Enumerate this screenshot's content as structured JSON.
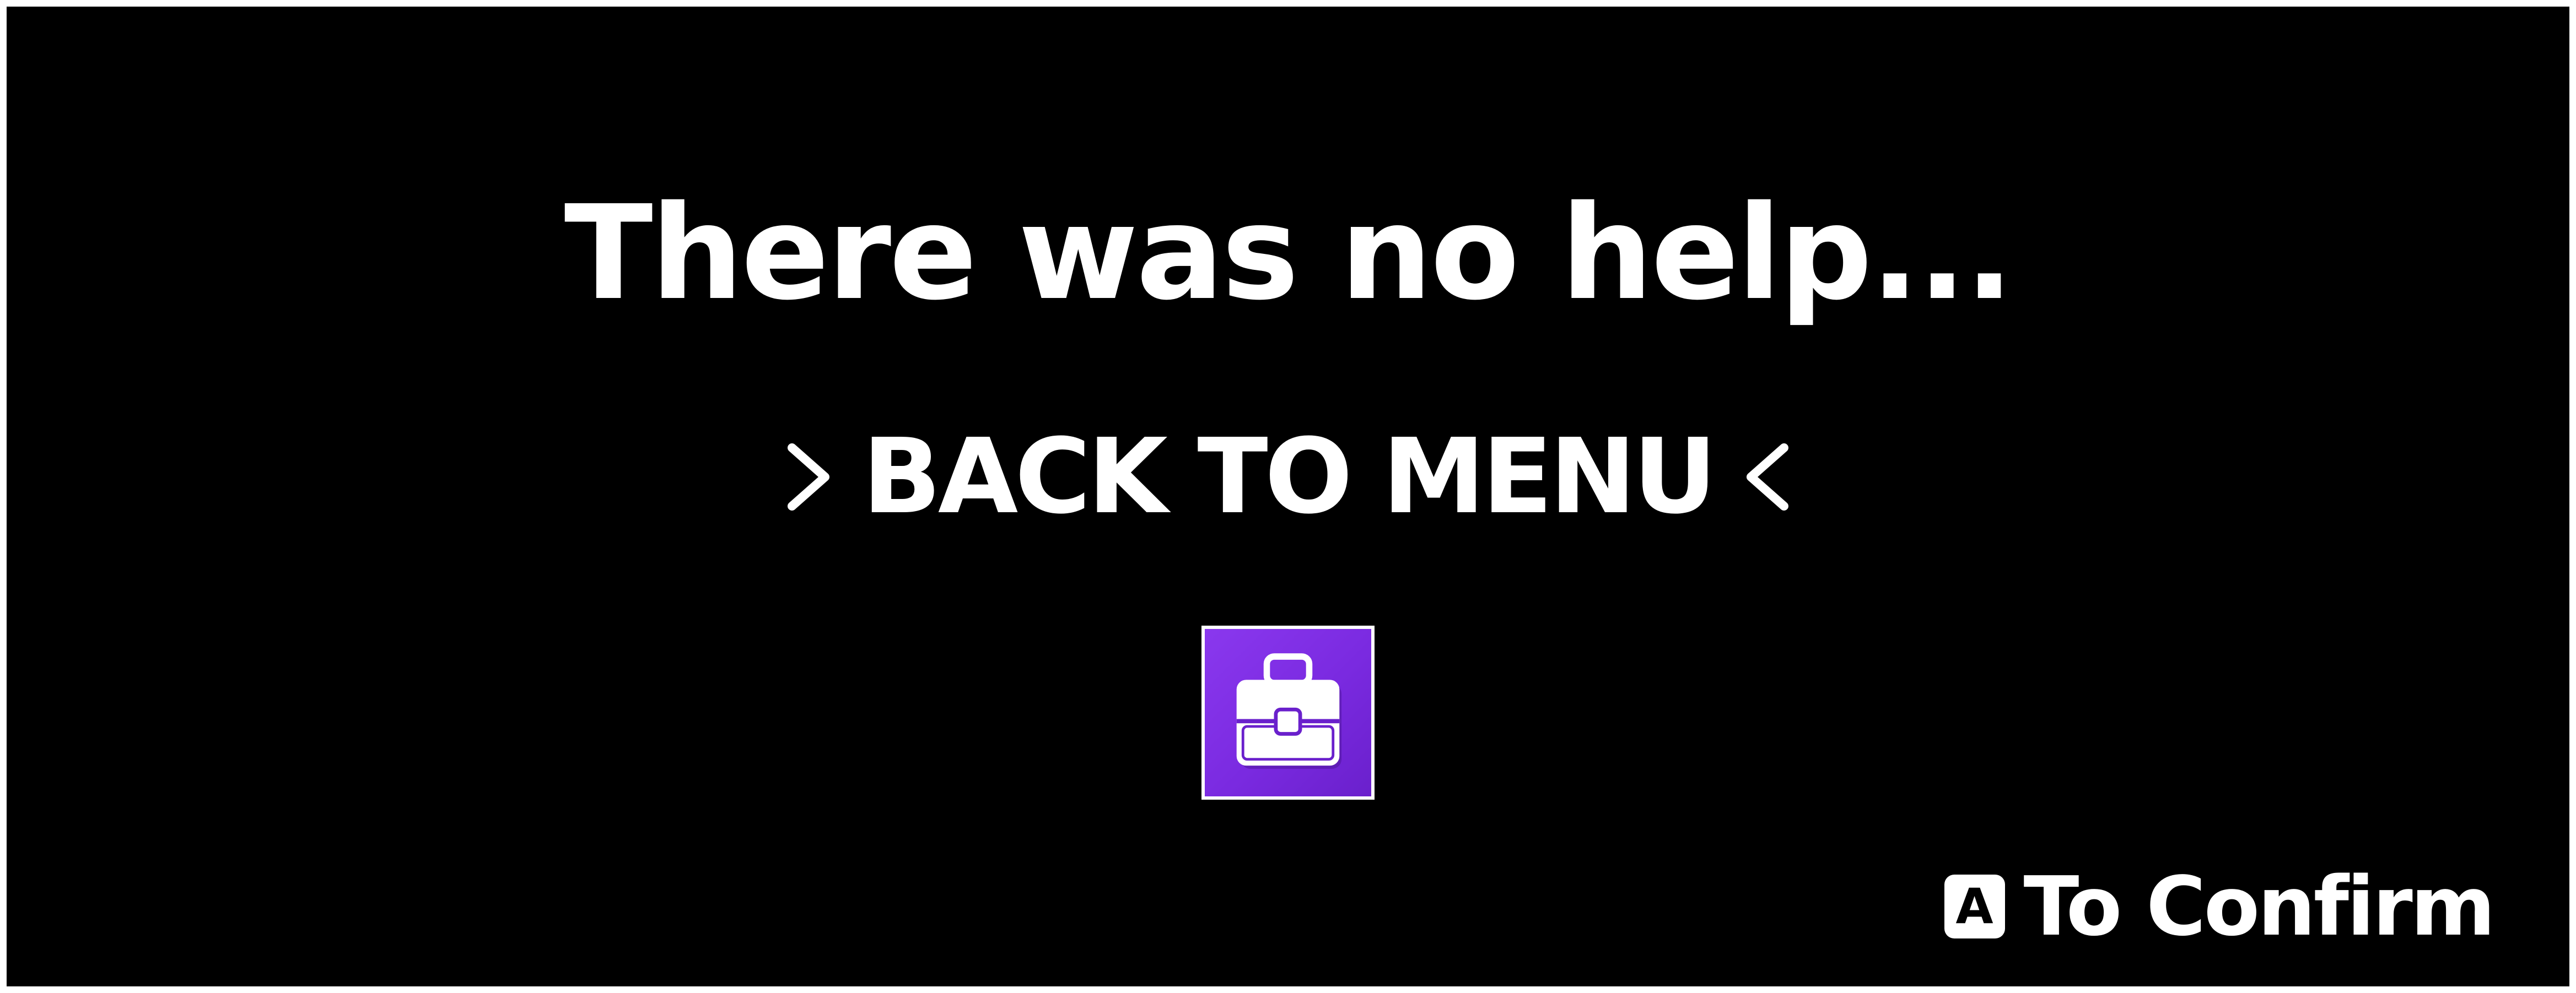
{
  "message": "There was no help...",
  "menu": {
    "selected_label": "BACK TO MENU",
    "left_cursor_icon": "chevron-right-icon",
    "right_cursor_icon": "chevron-left-icon"
  },
  "item": {
    "icon": "briefcase-icon",
    "background_color": "#7b2fe3"
  },
  "prompt": {
    "button_glyph": "A",
    "label": "To Confirm"
  }
}
